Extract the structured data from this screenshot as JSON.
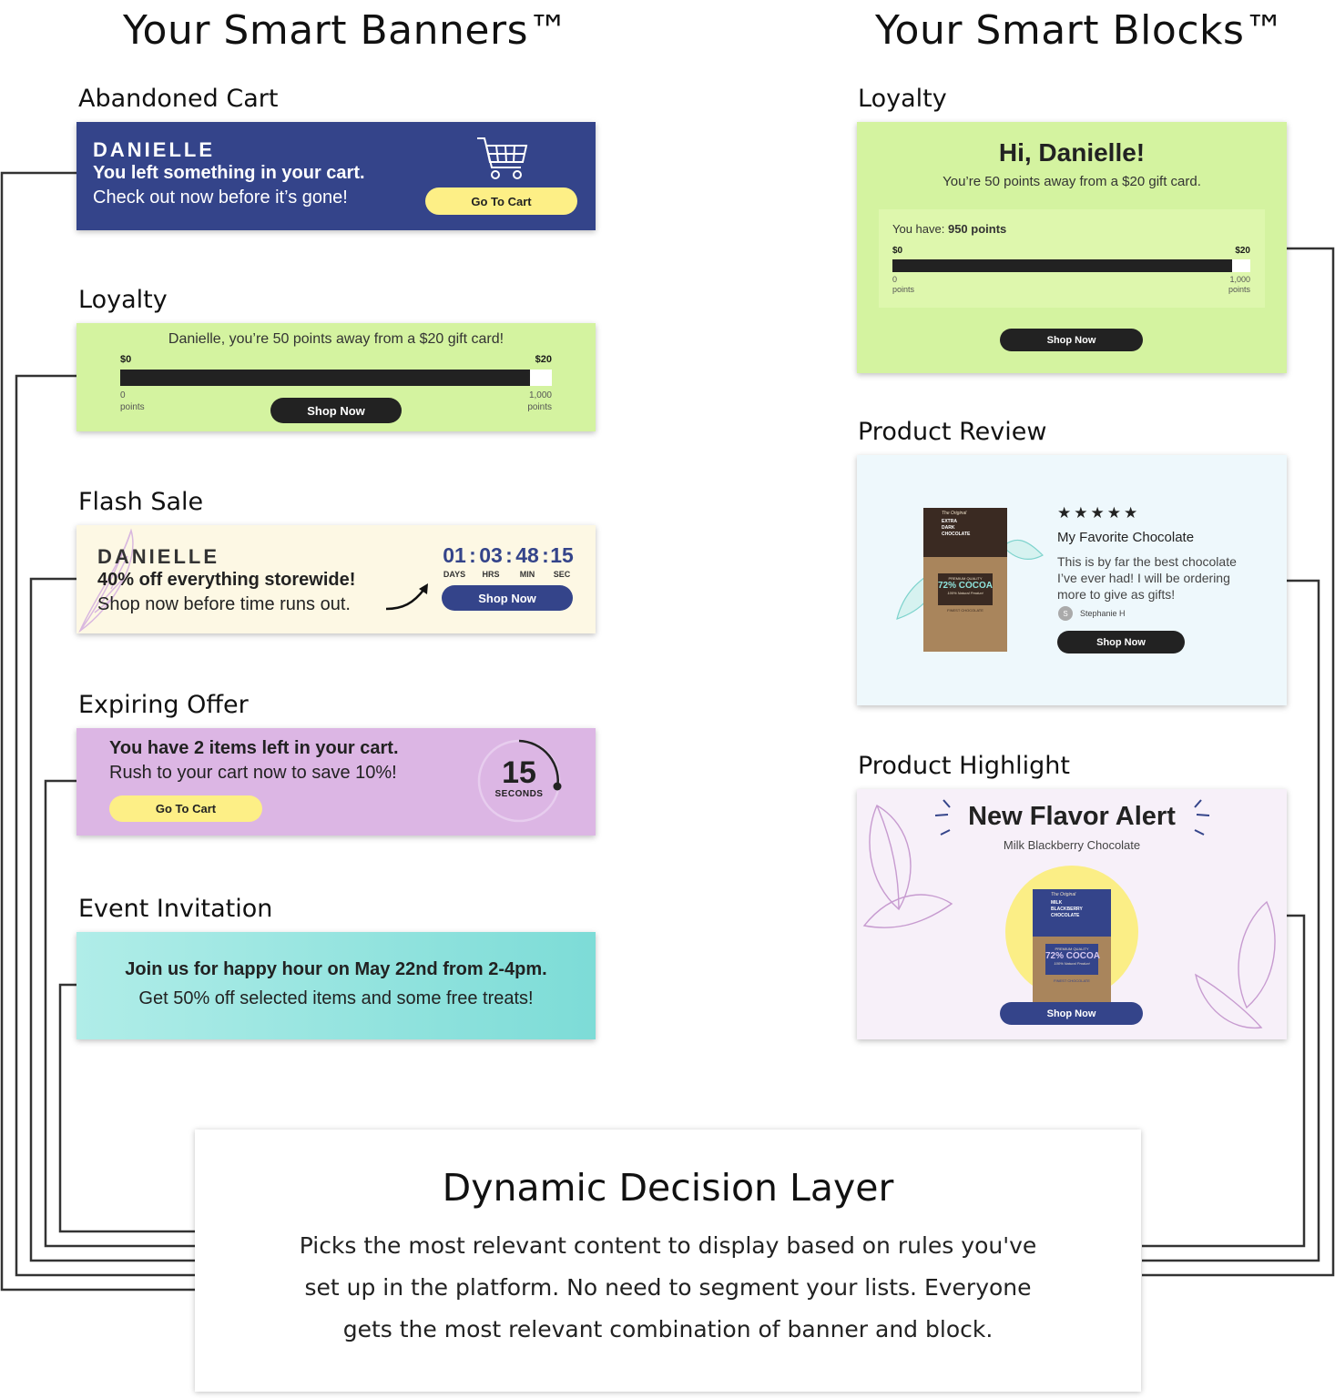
{
  "titles": {
    "banners": "Your Smart Banners™",
    "blocks": "Your Smart Blocks™"
  },
  "banners": {
    "abandoned_cart": {
      "section": "Abandoned Cart",
      "name": "DANIELLE",
      "line1": "You left something in your cart.",
      "line2": "Check out now before it’s gone!",
      "button": "Go To Cart"
    },
    "loyalty": {
      "section": "Loyalty",
      "headline": "Danielle, you’re 50 points away from a $20 gift card!",
      "min_label": "$0",
      "max_label": "$20",
      "min_points": "0",
      "max_points": "1,000",
      "points_word": "points",
      "button": "Shop Now",
      "progress": 0.95
    },
    "flash_sale": {
      "section": "Flash Sale",
      "name": "DANIELLE",
      "line1": "40% off everything storewide!",
      "line2": "Shop now before time runs out.",
      "countdown": [
        {
          "value": "01",
          "unit": "DAYS"
        },
        {
          "value": "03",
          "unit": "HRS"
        },
        {
          "value": "48",
          "unit": "MIN"
        },
        {
          "value": "15",
          "unit": "SEC"
        }
      ],
      "separator": ":",
      "button": "Shop Now"
    },
    "expiring_offer": {
      "section": "Expiring Offer",
      "line1": "You have 2 items left in your cart.",
      "line2": "Rush to your cart now to save 10%!",
      "button": "Go To Cart",
      "timer_value": "15",
      "timer_unit": "SECONDS"
    },
    "event_invitation": {
      "section": "Event Invitation",
      "line1": "Join us for happy hour on May 22nd from 2-4pm.",
      "line2": "Get 50% off selected items and some free treats!"
    }
  },
  "blocks": {
    "loyalty": {
      "section": "Loyalty",
      "greeting": "Hi, Danielle!",
      "subtitle": "You’re 50 points away from a $20 gift card.",
      "have_prefix": "You have: ",
      "have_value": "950 points",
      "min_label": "$0",
      "max_label": "$20",
      "min_points": "0",
      "max_points": "1,000",
      "points_word": "points",
      "button": "Shop Now",
      "progress": 0.95
    },
    "product_review": {
      "section": "Product Review",
      "stars": "★★★★★",
      "review_title": "My Favorite Chocolate",
      "review_text_1": "This is by far the best chocolate",
      "review_text_2": "I’ve ever had! I will be ordering",
      "review_text_3": "more to give as gifts!",
      "reviewer_initial": "S",
      "reviewer": "Stephanie H",
      "button": "Shop Now",
      "pkg_brand": "The Original",
      "pkg_name_1": "EXTRA",
      "pkg_name_2": "DARK",
      "pkg_name_3": "CHOCOLATE",
      "pkg_quality": "PREMIUM QUALITY",
      "pkg_cocoa": "72% COCOA",
      "pkg_note": "100% Natural Product",
      "pkg_footer": "FINEST CHOCOLATE"
    },
    "product_highlight": {
      "section": "Product Highlight",
      "title": "New Flavor Alert",
      "subtitle": "Milk Blackberry Chocolate",
      "button": "Shop Now",
      "pkg_brand": "The Original",
      "pkg_name_1": "MILK",
      "pkg_name_2": "BLACKBERRY",
      "pkg_name_3": "CHOCOLATE",
      "pkg_quality": "PREMIUM QUALITY",
      "pkg_cocoa": "72% COCOA",
      "pkg_note": "100% Natural Product",
      "pkg_footer": "FINEST CHOCOLATE"
    }
  },
  "decision_layer": {
    "title": "Dynamic Decision Layer",
    "line1": "Picks the most relevant content to display based on rules you've",
    "line2": "set up in the platform. No need to segment your lists. Everyone",
    "line3": "gets the most relevant combination of banner and block."
  },
  "colors": {
    "navy": "#34448a",
    "yellow": "#fdef86",
    "lime": "#d4f3a0",
    "cream": "#fdf8e4",
    "lavender": "#dcb6e4",
    "teal_start": "#b0ede8",
    "teal_end": "#7ddcd7",
    "review_bg": "#eef8fc",
    "highlight_bg": "#f7f0f9",
    "dark": "#222222",
    "connector": "#333333"
  }
}
